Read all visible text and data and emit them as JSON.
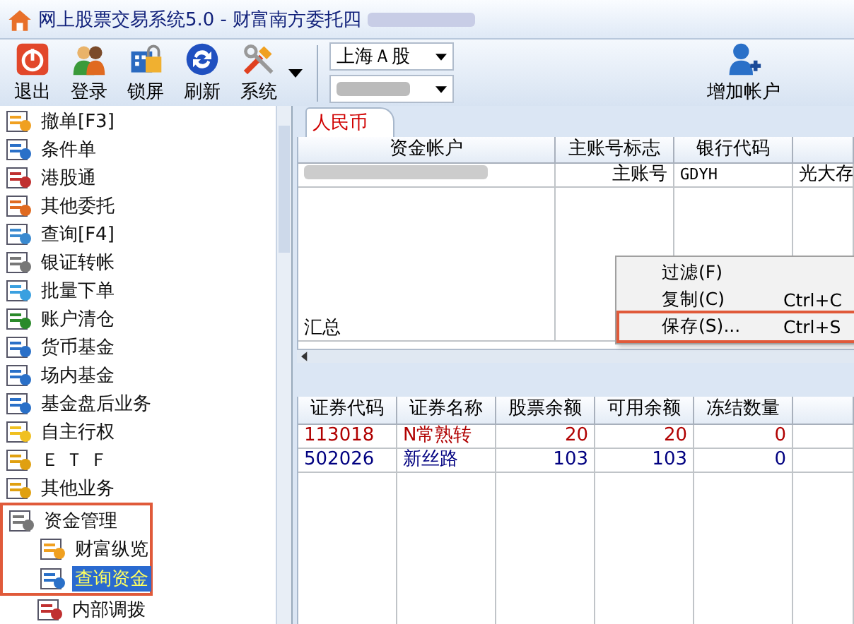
{
  "window": {
    "title": "网上股票交易系统5.0 - 财富南方委托四"
  },
  "toolbar": {
    "buttons": [
      {
        "label": "退出",
        "kind": "exit"
      },
      {
        "label": "登录",
        "kind": "login"
      },
      {
        "label": "锁屏",
        "kind": "lock"
      },
      {
        "label": "刷新",
        "kind": "refresh"
      },
      {
        "label": "系统",
        "kind": "system"
      }
    ],
    "market_select": {
      "value": "上海Ａ股"
    },
    "add_account": {
      "label": "增加帐户"
    }
  },
  "sidebar": {
    "items": [
      {
        "label": "撤单[F3]",
        "selected": false
      },
      {
        "label": "条件单",
        "selected": false
      },
      {
        "label": "港股通",
        "selected": false
      },
      {
        "label": "其他委托",
        "selected": false
      },
      {
        "label": "查询[F4]",
        "selected": false
      },
      {
        "label": "银证转帐",
        "selected": false
      },
      {
        "label": "批量下单",
        "selected": false
      },
      {
        "label": "账户清仓",
        "selected": false
      },
      {
        "label": "货币基金",
        "selected": false
      },
      {
        "label": "场内基金",
        "selected": false
      },
      {
        "label": "基金盘后业务",
        "selected": false
      },
      {
        "label": "自主行权",
        "selected": false
      },
      {
        "label": "Ｅ Ｔ Ｆ",
        "selected": false
      },
      {
        "label": "其他业务",
        "selected": false
      },
      {
        "label": "资金管理",
        "selected": false,
        "highlighted": true,
        "children": [
          {
            "label": "财富纵览",
            "selected": false
          },
          {
            "label": "查询资金",
            "selected": true
          },
          {
            "label": "内部调拨",
            "selected": false
          }
        ]
      }
    ]
  },
  "currency_tab": {
    "label": "人民币",
    "selected": true
  },
  "account_table": {
    "columns": [
      "资金帐户",
      "主账号标志",
      "银行代码"
    ],
    "rows": [
      [
        "",
        "主账号",
        "GDYH",
        "光大存"
      ]
    ],
    "summary": "汇总"
  },
  "context_menu": {
    "items": [
      {
        "label": "过滤(F)",
        "highlighted": false
      },
      {
        "label": "复制(C)",
        "shortcut": "Ctrl+C",
        "highlighted": false
      },
      {
        "label": "保存(S)...",
        "shortcut": "Ctrl+S",
        "highlighted": true
      }
    ]
  },
  "holdings_table": {
    "columns": [
      "证券代码",
      "证券名称",
      "股票余额",
      "可用余额",
      "冻结数量"
    ],
    "rows": [
      {
        "color": "#b00000",
        "cells": [
          "113018",
          "N常熟转",
          "20",
          "20",
          "0"
        ]
      },
      {
        "color": "#000080",
        "cells": [
          "502026",
          "新丝路",
          "103",
          "103",
          "0"
        ]
      }
    ]
  }
}
